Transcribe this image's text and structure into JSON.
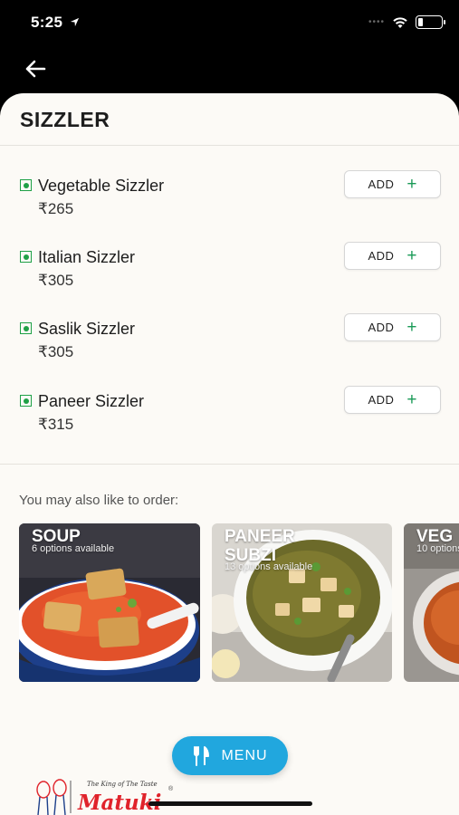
{
  "status_bar": {
    "time": "5:25",
    "signal": "••••"
  },
  "page": {
    "title": "SIZZLER"
  },
  "items": [
    {
      "name": "Vegetable Sizzler",
      "price": "₹265",
      "add_label": "ADD",
      "add_icon": "+"
    },
    {
      "name": "Italian Sizzler",
      "price": "₹305",
      "add_label": "ADD",
      "add_icon": "+"
    },
    {
      "name": "Saslik Sizzler",
      "price": "₹305",
      "add_label": "ADD",
      "add_icon": "+"
    },
    {
      "name": "Paneer Sizzler",
      "price": "₹315",
      "add_label": "ADD",
      "add_icon": "+"
    }
  ],
  "suggestions": {
    "heading": "You may also like to order:",
    "cards": [
      {
        "title": "SOUP",
        "title_line2": "",
        "subtitle": "6 options available"
      },
      {
        "title": "PANEER",
        "title_line2": "SUBZI",
        "subtitle": "13 options available"
      },
      {
        "title": "VEG",
        "title_line2": "",
        "subtitle": "10 options"
      }
    ]
  },
  "menu_button": {
    "label": "MENU"
  },
  "brand": {
    "tagline": "The King of The Taste",
    "name": "Matuki",
    "reg": "®"
  },
  "colors": {
    "accent_blue": "#21a7de",
    "veg_green": "#1fa046",
    "add_green": "#1a9a57",
    "brand_red": "#e0232b",
    "sheet_bg": "#fcfaf6"
  },
  "icons": {
    "back": "arrow-left-icon",
    "menu": "fork-knife-icon",
    "wifi": "wifi-icon",
    "battery": "battery-icon",
    "location": "location-arrow-icon"
  }
}
